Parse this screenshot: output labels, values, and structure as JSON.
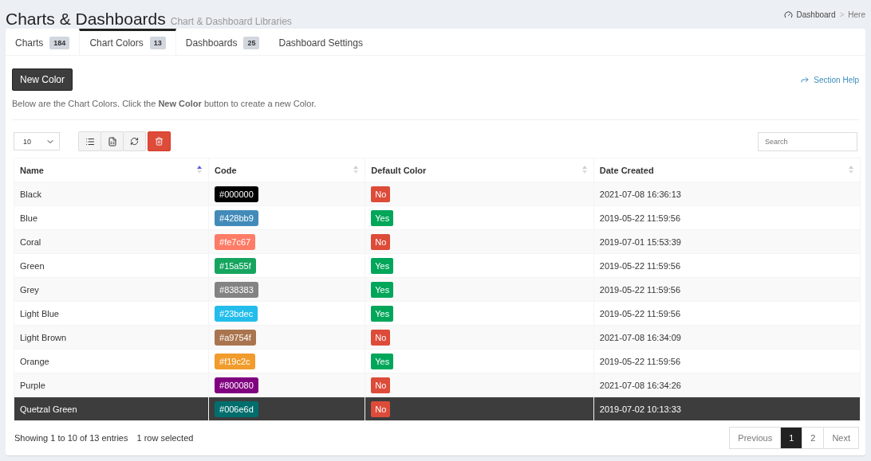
{
  "header": {
    "title": "Charts & Dashboards",
    "subtitle": "Chart & Dashboard Libraries",
    "breadcrumb": [
      "Dashboard",
      ">",
      "Here"
    ]
  },
  "tabs": [
    {
      "label": "Charts",
      "count": "184",
      "selected": false
    },
    {
      "label": "Chart Colors",
      "count": "13",
      "selected": true
    },
    {
      "label": "Dashboards",
      "count": "25",
      "selected": false
    },
    {
      "label": "Dashboard Settings",
      "selected": false
    }
  ],
  "new_button": "New Color",
  "help_link": "Section Help",
  "intro": "Below are the Chart Colors. Click the **New Color** button to create a new Color.",
  "page_size": "10",
  "search": {
    "placeholder": "Search"
  },
  "table": {
    "columns": [
      {
        "label": "Name",
        "sorted": true
      },
      {
        "label": "Code",
        "sorted": false
      },
      {
        "label": "Default Color",
        "sorted": false
      },
      {
        "label": "Date Created",
        "sorted": false
      }
    ],
    "rows": [
      {
        "name": "Black",
        "code": "#000000",
        "color": "#000000",
        "default": "No",
        "is_default": false,
        "date": "2021-07-08 16:36:13",
        "selected": false
      },
      {
        "name": "Blue",
        "code": "#428bb9",
        "color": "#428bb9",
        "default": "Yes",
        "is_default": true,
        "date": "2019-05-22 11:59:56",
        "selected": false
      },
      {
        "name": "Coral",
        "code": "#fe7c67",
        "color": "#fe7c67",
        "default": "No",
        "is_default": false,
        "date": "2019-07-01 15:53:39",
        "selected": false
      },
      {
        "name": "Green",
        "code": "#15a55f",
        "color": "#15a55f",
        "default": "Yes",
        "is_default": true,
        "date": "2019-05-22 11:59:56",
        "selected": false
      },
      {
        "name": "Grey",
        "code": "#838383",
        "color": "#838383",
        "default": "Yes",
        "is_default": true,
        "date": "2019-05-22 11:59:56",
        "selected": false
      },
      {
        "name": "Light Blue",
        "code": "#23bdec",
        "color": "#23bdec",
        "default": "Yes",
        "is_default": true,
        "date": "2019-05-22 11:59:56",
        "selected": false
      },
      {
        "name": "Light Brown",
        "code": "#a9754f",
        "color": "#a9754f",
        "default": "No",
        "is_default": false,
        "date": "2021-07-08 16:34:09",
        "selected": false
      },
      {
        "name": "Orange",
        "code": "#f19c2c",
        "color": "#f19c2c",
        "default": "Yes",
        "is_default": true,
        "date": "2019-05-22 11:59:56",
        "selected": false
      },
      {
        "name": "Purple",
        "code": "#800080",
        "color": "#800080",
        "default": "No",
        "is_default": false,
        "date": "2021-07-08 16:34:26",
        "selected": false
      },
      {
        "name": "Quetzal Green",
        "code": "#006e6d",
        "color": "#006e6d",
        "default": "No",
        "is_default": false,
        "date": "2019-07-02 10:13:33",
        "selected": true
      }
    ]
  },
  "info": "Showing 1 to 10 of 13 entries",
  "selection_info": "1 row selected",
  "pagination": [
    {
      "label": "Previous",
      "kind": "nav",
      "selected": false
    },
    {
      "label": "1",
      "kind": "page",
      "selected": true
    },
    {
      "label": "2",
      "kind": "page",
      "selected": false
    },
    {
      "label": "Next",
      "kind": "nav",
      "selected": false
    }
  ]
}
